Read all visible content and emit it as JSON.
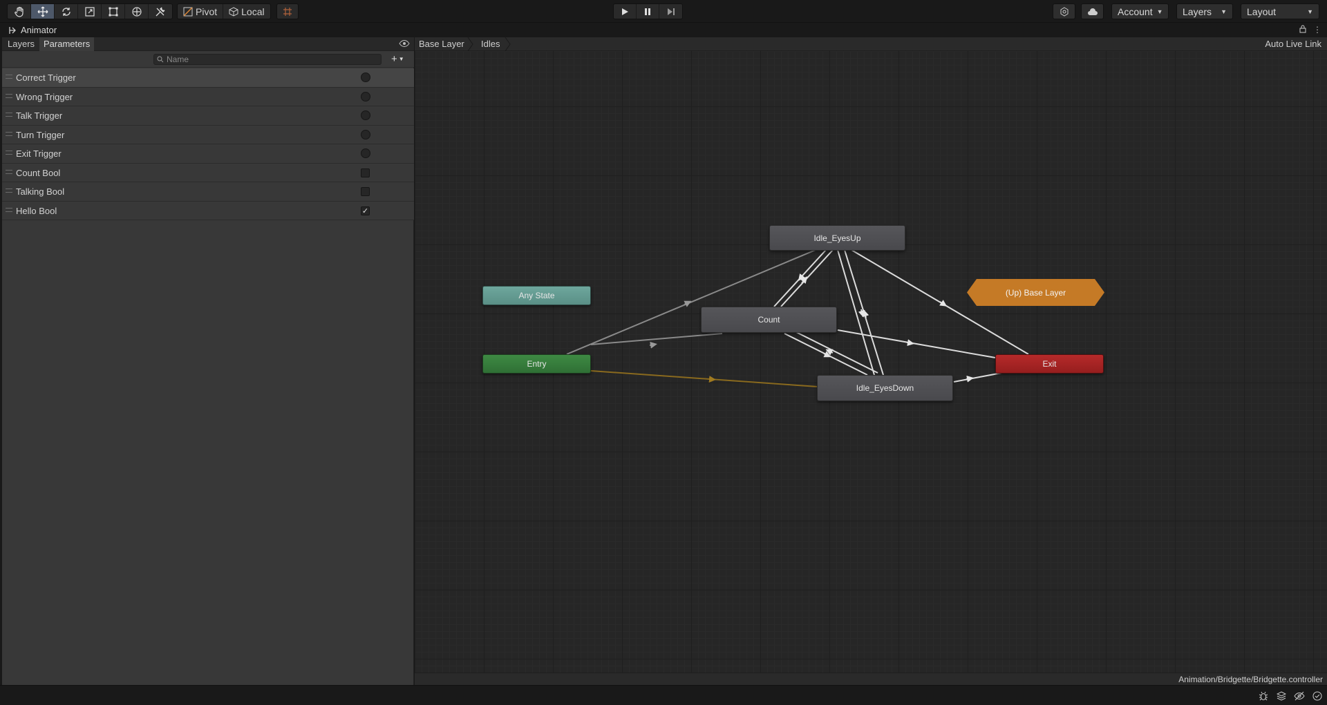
{
  "toolbar": {
    "pivot_label": "Pivot",
    "local_label": "Local",
    "account_label": "Account",
    "layers_label": "Layers",
    "layout_label": "Layout"
  },
  "window": {
    "title": "Animator"
  },
  "left_panel": {
    "tabs": [
      "Layers",
      "Parameters"
    ],
    "active_tab": "Parameters",
    "search_placeholder": "Name",
    "parameters": [
      {
        "name": "Correct Trigger",
        "type": "trigger"
      },
      {
        "name": "Wrong Trigger",
        "type": "trigger"
      },
      {
        "name": "Talk Trigger",
        "type": "trigger"
      },
      {
        "name": "Turn Trigger",
        "type": "trigger"
      },
      {
        "name": "Exit Trigger",
        "type": "trigger"
      },
      {
        "name": "Count Bool",
        "type": "bool",
        "checked": false
      },
      {
        "name": "Talking Bool",
        "type": "bool",
        "checked": false
      },
      {
        "name": "Hello Bool",
        "type": "bool",
        "checked": true
      }
    ]
  },
  "graph": {
    "breadcrumbs": [
      "Base Layer",
      "Idles"
    ],
    "auto_live_link": "Auto Live Link",
    "nodes": {
      "idle_eyes_up": "Idle_EyesUp",
      "any_state": "Any State",
      "count": "Count",
      "up_base_layer": "(Up) Base Layer",
      "entry": "Entry",
      "exit": "Exit",
      "idle_eyes_down": "Idle_EyesDown"
    },
    "colors": {
      "entry": "#2f6f35",
      "any_state": "#5a8f86",
      "exit": "#961e1e",
      "up_base_layer": "#c57a26",
      "state": "#4b4b4f",
      "default_transition": "#8a6a1e"
    }
  },
  "status": {
    "controller_path": "Animation/Bridgette/Bridgette.controller"
  }
}
